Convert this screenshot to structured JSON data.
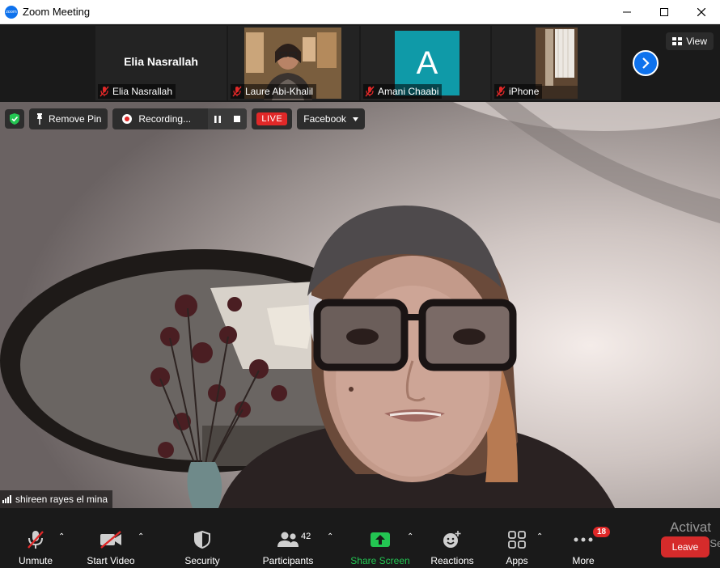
{
  "window": {
    "title": "Zoom Meeting",
    "logo_text": "zoom",
    "controls": [
      "minimize",
      "maximize",
      "close"
    ]
  },
  "gallery": {
    "tiles": [
      {
        "name": "Elia  Nasrallah",
        "center_label": "Elia  Nasrallah",
        "muted": true
      },
      {
        "name": "Laure Abi-Khalil",
        "muted": true
      },
      {
        "name": "Amani Chaabi",
        "avatar_letter": "A",
        "muted": true
      },
      {
        "name": "iPhone",
        "muted": true
      }
    ],
    "view_label": "View"
  },
  "meeting_bar": {
    "remove_pin": "Remove Pin",
    "recording": "Recording...",
    "live": "LIVE",
    "stream_target": "Facebook"
  },
  "speaker": {
    "name": "shireen rayes el mina"
  },
  "toolbar": {
    "unmute": "Unmute",
    "start_video": "Start Video",
    "security": "Security",
    "participants": "Participants",
    "participants_count": "42",
    "share_screen": "Share Screen",
    "reactions": "Reactions",
    "apps": "Apps",
    "more": "More",
    "more_badge": "18",
    "leave": "Leave"
  },
  "watermark": {
    "line1": "Activat",
    "line2": "Go to Set"
  },
  "colors": {
    "accent": "#0e72ed",
    "danger": "#e02828",
    "share_green": "#23c552",
    "toolbar_bg": "#1a1a1a"
  }
}
